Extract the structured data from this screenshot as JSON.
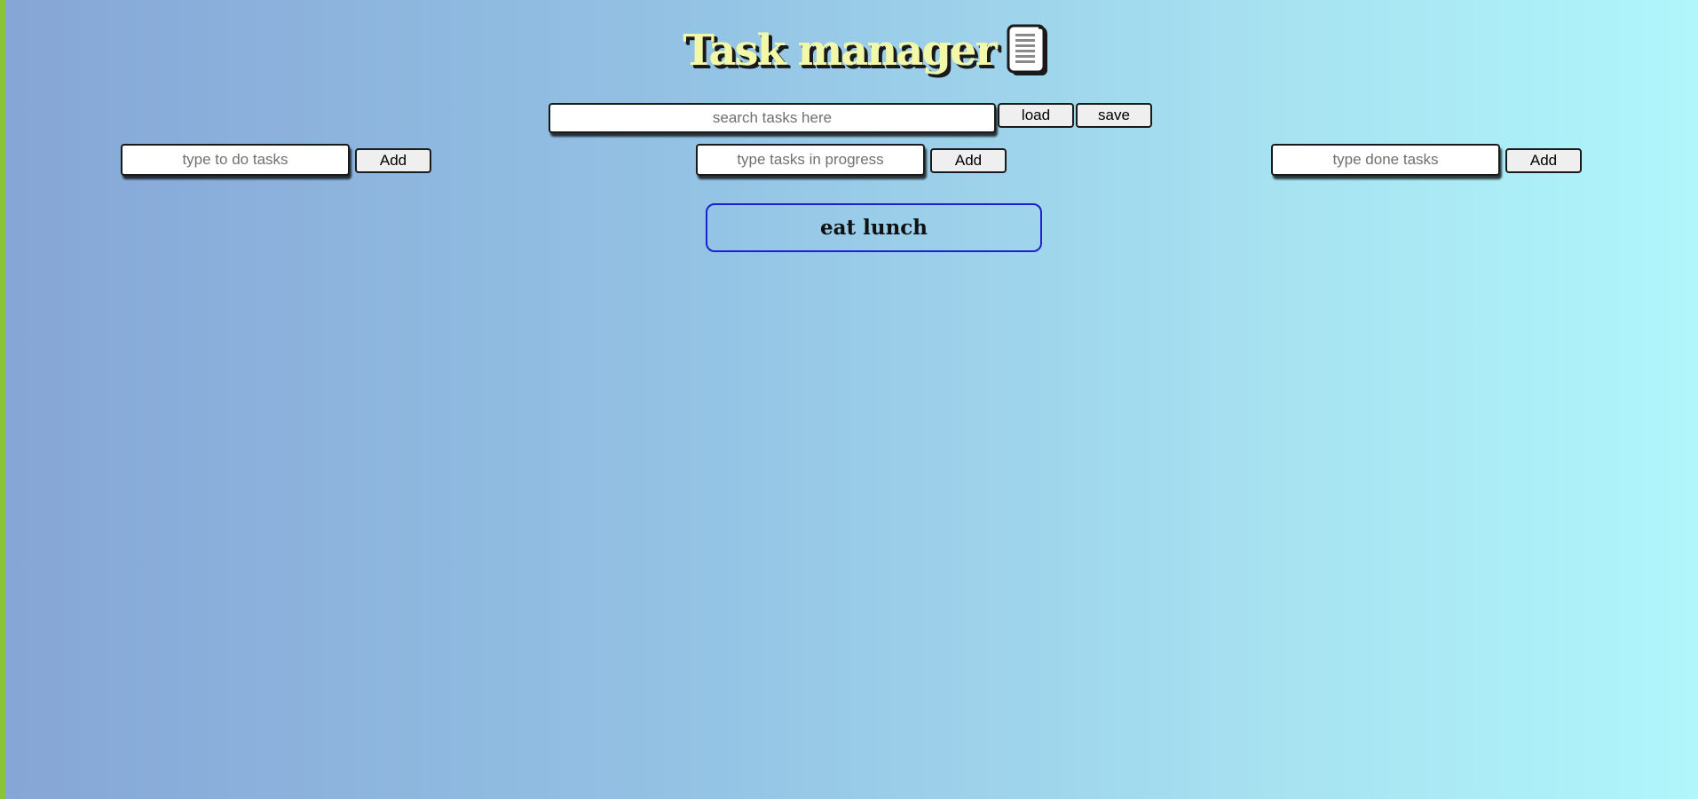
{
  "header": {
    "title": "Task manager",
    "icon": "document-list-icon"
  },
  "search": {
    "placeholder": "search tasks here",
    "value": ""
  },
  "toolbar": {
    "load_label": "load",
    "save_label": "save"
  },
  "columns": {
    "todo": {
      "placeholder": "type to do tasks",
      "add_label": "Add"
    },
    "in_progress": {
      "placeholder": "type tasks in progress",
      "add_label": "Add"
    },
    "done": {
      "placeholder": "type done tasks",
      "add_label": "Add"
    }
  },
  "tasks": [
    {
      "text": "eat lunch",
      "border_color": "#1f1fd0"
    }
  ],
  "colors": {
    "title": "#f3f8a8",
    "accent_bar": "#8ac23a",
    "task_border": "#1f1fd0"
  }
}
